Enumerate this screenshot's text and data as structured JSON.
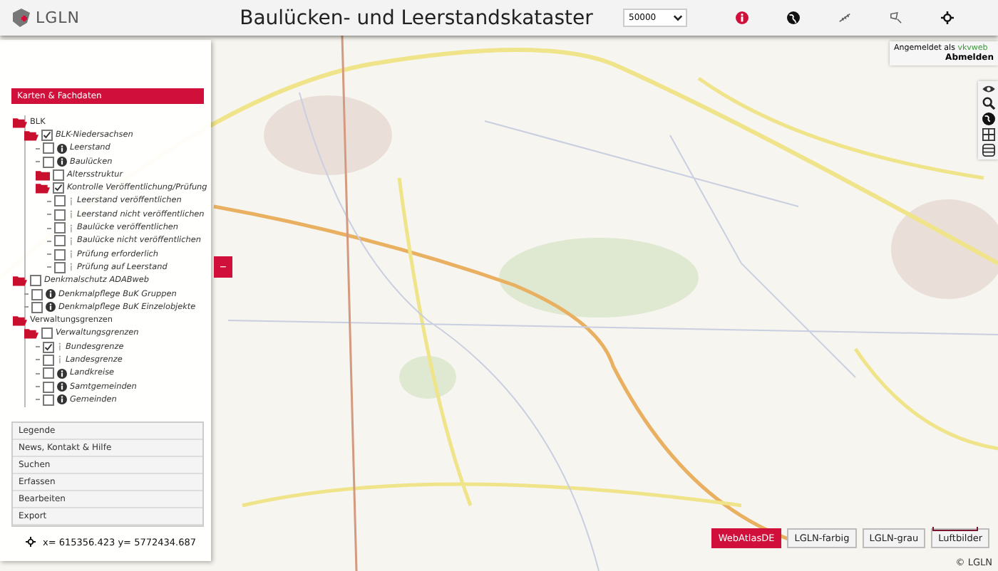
{
  "header": {
    "logo": "LGLN",
    "title": "Baulücken- und Leerstandskataster",
    "scale": "50000"
  },
  "login": {
    "label": "Angemeldet als",
    "user": "vkvweb",
    "logout": "Abmelden"
  },
  "panel": {
    "heading": "Karten & Fachdaten",
    "collapse": "−",
    "tree": [
      {
        "label": "BLK",
        "kind": "folder",
        "expanded": true,
        "children": [
          {
            "label": "BLK-Niedersachsen",
            "kind": "folder",
            "expanded": true,
            "checked": true,
            "children": [
              {
                "label": "Leerstand",
                "kind": "layer",
                "checked": false
              },
              {
                "label": "Baulücken",
                "kind": "layer",
                "checked": false
              },
              {
                "label": "Altersstruktur",
                "kind": "folder",
                "expanded": false,
                "checked": false
              },
              {
                "label": "Kontrolle Veröffentlichung/Prüfung",
                "kind": "folder",
                "expanded": true,
                "checked": true,
                "children": [
                  {
                    "label": "Leerstand veröffentlichen",
                    "kind": "sublayer",
                    "checked": false
                  },
                  {
                    "label": "Leerstand nicht veröffentlichen",
                    "kind": "sublayer",
                    "checked": false
                  },
                  {
                    "label": "Baulücke veröffentlichen",
                    "kind": "sublayer",
                    "checked": false
                  },
                  {
                    "label": "Baulücke nicht veröffentlichen",
                    "kind": "sublayer",
                    "checked": false
                  },
                  {
                    "label": "Prüfung erforderlich",
                    "kind": "sublayer",
                    "checked": false
                  },
                  {
                    "label": "Prüfung auf Leerstand",
                    "kind": "sublayer",
                    "checked": false
                  }
                ]
              }
            ]
          }
        ]
      },
      {
        "label": "Denkmalschutz ADABweb",
        "kind": "folder",
        "expanded": true,
        "checked": false,
        "children": [
          {
            "label": "Denkmalpflege BuK Gruppen",
            "kind": "layer",
            "checked": false
          },
          {
            "label": "Denkmalpflege BuK Einzelobjekte",
            "kind": "layer",
            "checked": false
          }
        ]
      },
      {
        "label": "Verwaltungsgrenzen",
        "kind": "folder",
        "expanded": true,
        "children": [
          {
            "label": "Verwaltungsgrenzen",
            "kind": "folder",
            "expanded": true,
            "checked": false,
            "children": [
              {
                "label": "Bundesgrenze",
                "kind": "sublayer",
                "checked": true
              },
              {
                "label": "Landesgrenze",
                "kind": "sublayer",
                "checked": false
              },
              {
                "label": "Landkreise",
                "kind": "layer",
                "checked": false
              },
              {
                "label": "Samtgemeinden",
                "kind": "layer",
                "checked": false
              },
              {
                "label": "Gemeinden",
                "kind": "layer",
                "checked": false
              }
            ]
          }
        ]
      }
    ],
    "menu": [
      "Legende",
      "News, Kontakt & Hilfe",
      "Suchen",
      "Erfassen",
      "Bearbeiten",
      "Export"
    ]
  },
  "coordinates": "x= 615356.423 y= 5772434.687",
  "basemaps": [
    {
      "label": "WebAtlasDE",
      "selected": true
    },
    {
      "label": "LGLN-farbig",
      "selected": false
    },
    {
      "label": "LGLN-grau",
      "selected": false
    },
    {
      "label": "Luftbilder",
      "selected": false
    }
  ],
  "copyright": "© LGLN"
}
